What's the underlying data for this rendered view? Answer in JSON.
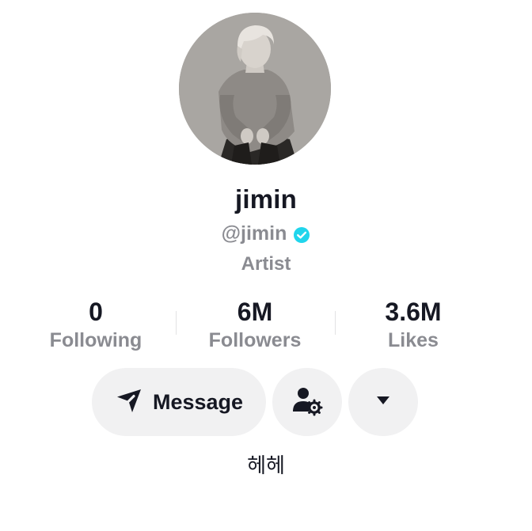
{
  "profile": {
    "display_name": "jimin",
    "handle": "@jimin",
    "category": "Artist",
    "verified_color": "#20D5EC",
    "avatar_description_icon": "profile-photo"
  },
  "stats": [
    {
      "value": "0",
      "label": "Following"
    },
    {
      "value": "6M",
      "label": "Followers"
    },
    {
      "value": "3.6M",
      "label": "Likes"
    }
  ],
  "actions": {
    "message_label": "Message",
    "message_icon": "send-arrow-icon",
    "suggest_icon": "user-settings-icon",
    "more_icon": "caret-down-icon"
  },
  "bio": "헤헤",
  "colors": {
    "text_primary": "#161823",
    "text_secondary": "#8A8B91",
    "button_bg": "#F1F1F2"
  }
}
